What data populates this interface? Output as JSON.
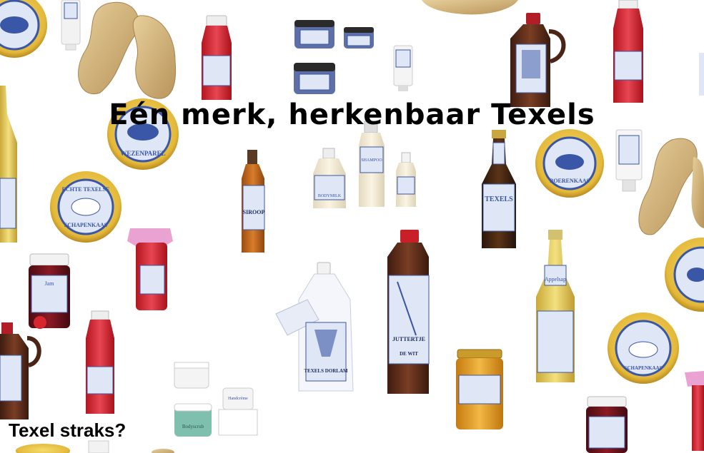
{
  "headline": "Eén merk, herkenbaar Texels",
  "question": "Texel straks?",
  "products": {
    "wezenpareltje": "WEZENPAREL",
    "schapenkaas": "SCHAPENKAAS",
    "boerenkaas": "BOERENKAAS",
    "echte_texelse": "ECHTE TEXELSE",
    "siroop": "SIROOP",
    "bodymilk": "BODYMILK",
    "shampoo": "SHAMPOO",
    "texels_beer": "TEXELS",
    "jutterje": "JUTTERTJE",
    "de_wit": "DE WIT",
    "dorlam": "TEXELS DORLAM",
    "appelsap": "Appelsap",
    "jam": "Jam",
    "handcreme": "Handcrème",
    "bodyscrub": "Bodyscrub"
  },
  "colors": {
    "label_blue": "#3a56a6",
    "cheese_yellow": "#e9c84a",
    "cheese_rind": "#c99a2a",
    "label_bg": "#dfe6f5",
    "red_juice": "#d8262f",
    "amber_syrup": "#c2661f",
    "brown_jug": "#5a2e1c",
    "sole": "#d8b985",
    "honey": "#e09a1e"
  }
}
